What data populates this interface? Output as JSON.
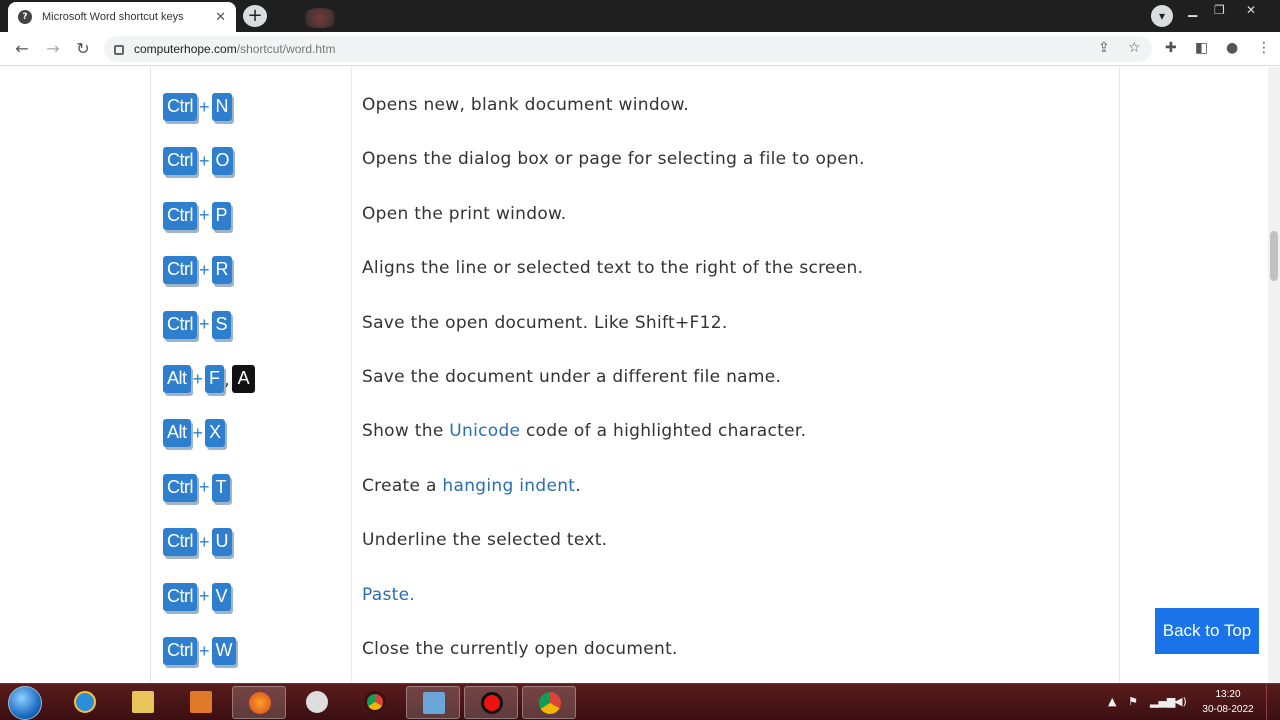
{
  "browser": {
    "tab_title": "Microsoft Word shortcut keys",
    "tab_close": "✕",
    "new_tab": "+",
    "url_domain": "computerhope.com",
    "url_path": "/shortcut/word.htm"
  },
  "shortcuts": [
    {
      "keys": [
        "Ctrl",
        "N"
      ],
      "description": "Opens new, blank document window."
    },
    {
      "keys": [
        "Ctrl",
        "O"
      ],
      "description": "Opens the dialog box or page for selecting a file to open."
    },
    {
      "keys": [
        "Ctrl",
        "P"
      ],
      "description": "Open the print window."
    },
    {
      "keys": [
        "Ctrl",
        "R"
      ],
      "description": "Aligns the line or selected text to the right of the screen."
    },
    {
      "keys": [
        "Ctrl",
        "S"
      ],
      "description": "Save the open document. Like Shift+F12."
    },
    {
      "keys": [
        "Alt",
        "F"
      ],
      "extra_key": "A",
      "description": "Save the document under a different file name."
    },
    {
      "keys": [
        "Alt",
        "X"
      ],
      "desc_before": "Show the ",
      "desc_link": "Unicode",
      "desc_after": " code of a highlighted character."
    },
    {
      "keys": [
        "Ctrl",
        "T"
      ],
      "desc_before": "Create a ",
      "desc_link": "hanging indent",
      "desc_after": "."
    },
    {
      "keys": [
        "Ctrl",
        "U"
      ],
      "description": "Underline the selected text."
    },
    {
      "keys": [
        "Ctrl",
        "V"
      ],
      "desc_link": "Paste."
    },
    {
      "keys": [
        "Ctrl",
        "W"
      ],
      "description": "Close the currently open document."
    }
  ],
  "back_to_top": "Back to Top",
  "taskbar": {
    "time": "13:20",
    "date": "30-08-2022"
  },
  "colors": {
    "key_blue": "#2f7fcf",
    "link_blue": "#2a6db5",
    "button_blue": "#1a73e8",
    "taskbar": "#4a1518"
  }
}
